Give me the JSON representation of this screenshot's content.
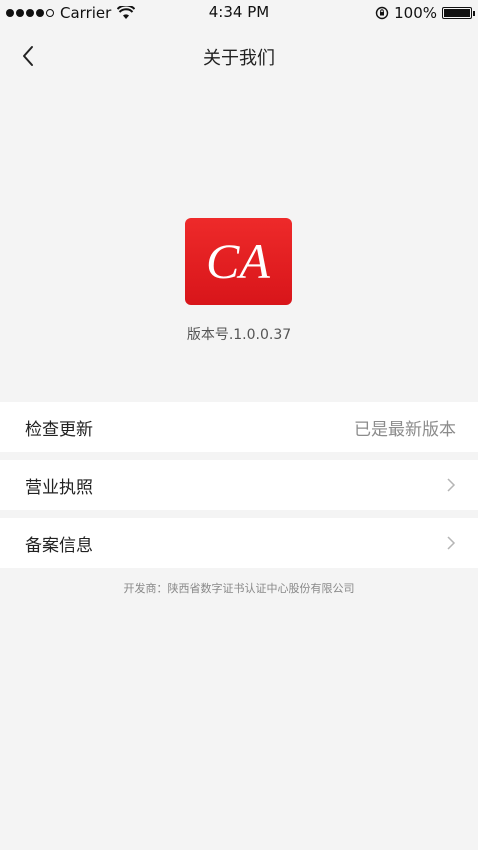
{
  "status_bar": {
    "carrier": "Carrier",
    "time": "4:34 PM",
    "battery": "100%"
  },
  "nav": {
    "title": "关于我们"
  },
  "logo": {
    "text": "CA"
  },
  "version": "版本号.1.0.0.37",
  "list": [
    {
      "label": "检查更新",
      "value": "已是最新版本"
    },
    {
      "label": "营业执照",
      "value": ""
    },
    {
      "label": "备案信息",
      "value": ""
    }
  ],
  "footer": "开发商：陕西省数字证书认证中心股份有限公司",
  "colors": {
    "background": "#f4f4f4",
    "logo_red": "#e11f24",
    "row_bg": "#ffffff"
  }
}
